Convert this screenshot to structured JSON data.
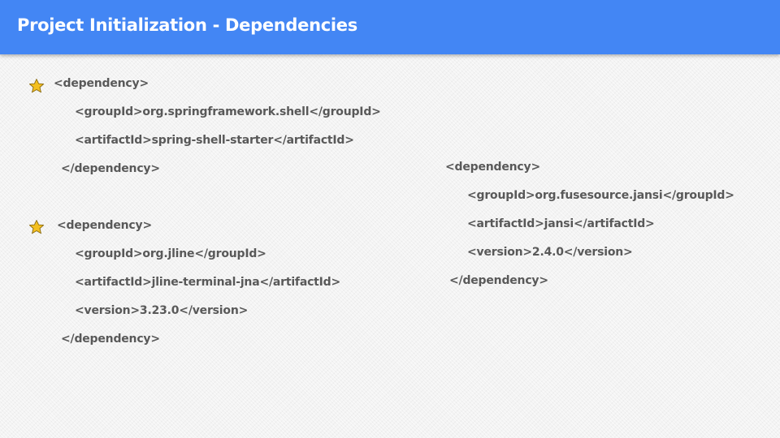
{
  "header": {
    "title": "Project Initialization - Dependencies",
    "background": "#4386f4",
    "text_color": "#ffffff"
  },
  "text_color": "#595959",
  "star_color": "#f4c020",
  "dependency_1": {
    "open": "<dependency>",
    "group_id": "<groupId>org.springframework.shell</groupId>",
    "artifact_id": "<artifactId>spring-shell-starter</artifactId>",
    "close": "</dependency>"
  },
  "dependency_2": {
    "open": "<dependency>",
    "group_id": "<groupId>org.jline</groupId>",
    "artifact_id": "<artifactId>jline-terminal-jna</artifactId>",
    "version": "<version>3.23.0</version>",
    "close": "</dependency>"
  },
  "dependency_3": {
    "open": "<dependency>",
    "group_id": "<groupId>org.fusesource.jansi</groupId>",
    "artifact_id": "<artifactId>jansi</artifactId>",
    "version": "<version>2.4.0</version>",
    "close": "</dependency>"
  },
  "icons": [
    "star-icon",
    "star-icon"
  ]
}
